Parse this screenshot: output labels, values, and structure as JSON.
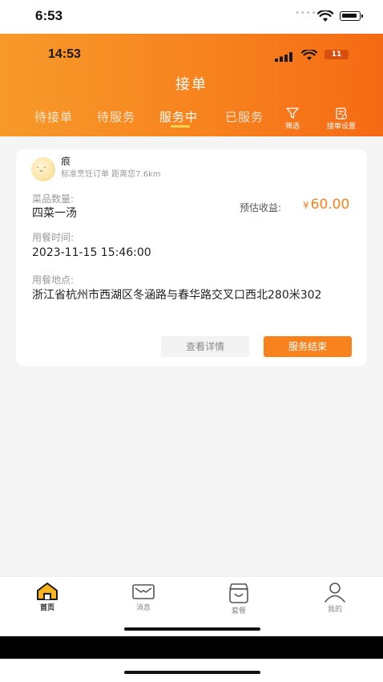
{
  "outer_status": {
    "time": "6:53",
    "dots": "••••"
  },
  "inner_status": {
    "time": "14:53",
    "battery": "11"
  },
  "header": {
    "title": "接单",
    "tabs": [
      {
        "label": "待接单"
      },
      {
        "label": "待服务"
      },
      {
        "label": "服务中",
        "active": true
      },
      {
        "label": "已服务"
      }
    ],
    "filter_label": "筛选",
    "settings_label": "接单设置"
  },
  "order": {
    "cook_name": "痕",
    "cook_meta": "标准烹饪订单  距离您7.6km",
    "dish_count_label": "菜品数量:",
    "dish_count": "四菜一汤",
    "income_label": "预估收益:",
    "income_currency": "¥",
    "income_value": "60.00",
    "time_label": "用餐时间:",
    "time_value": "2023-11-15 15:46:00",
    "address_label": "用餐地点:",
    "address_value": "浙江省杭州市西湖区冬涵路与春华路交叉口西北280米302",
    "detail_button": "查看详情",
    "finish_button": "服务结束"
  },
  "tabbar": {
    "items": [
      {
        "label": "首页",
        "icon": "home-icon",
        "active": true
      },
      {
        "label": "消息",
        "icon": "message-icon"
      },
      {
        "label": "套餐",
        "icon": "package-icon"
      },
      {
        "label": "我的",
        "icon": "profile-icon"
      }
    ]
  },
  "colors": {
    "accent": "#f7821e",
    "tab_underline": "#ffd34d"
  }
}
